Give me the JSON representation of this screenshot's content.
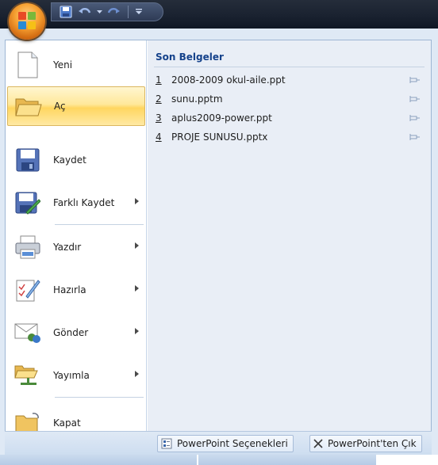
{
  "quick_access": {
    "save_icon": "save-icon",
    "undo_icon": "undo-icon",
    "redo_icon": "redo-icon",
    "customize_icon": "customize-qat-icon"
  },
  "office_button": {
    "icon": "office-logo-icon"
  },
  "menu": {
    "items": [
      {
        "label": "Yeni",
        "icon": "new-document-icon",
        "submenu": false
      },
      {
        "label": "Aç",
        "icon": "open-folder-icon",
        "submenu": false
      },
      {
        "label": "Kaydet",
        "icon": "save-disk-icon",
        "submenu": false
      },
      {
        "label": "Farklı Kaydet",
        "icon": "save-as-icon",
        "submenu": true
      },
      {
        "label": "Yazdır",
        "icon": "printer-icon",
        "submenu": true
      },
      {
        "label": "Hazırla",
        "icon": "prepare-icon",
        "submenu": true
      },
      {
        "label": "Gönder",
        "icon": "send-icon",
        "submenu": true
      },
      {
        "label": "Yayımla",
        "icon": "publish-icon",
        "submenu": true
      },
      {
        "label": "Kapat",
        "icon": "close-folder-icon",
        "submenu": false
      }
    ]
  },
  "recent": {
    "title": "Son Belgeler",
    "files": [
      {
        "num": "1",
        "name": "2008-2009 okul-aile.ppt"
      },
      {
        "num": "2",
        "name": "sunu.pptm"
      },
      {
        "num": "3",
        "name": "aplus2009-power.ppt"
      },
      {
        "num": "4",
        "name": "PROJE SUNUSU.pptx"
      }
    ]
  },
  "footer": {
    "options_label": "PowerPoint Seçenekleri",
    "exit_label": "PowerPoint'ten Çık"
  }
}
